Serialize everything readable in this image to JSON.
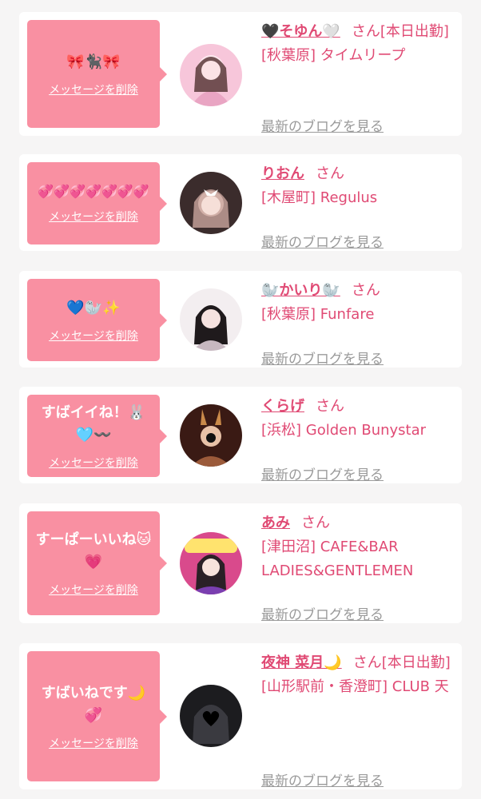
{
  "delete_label": "メッセージを削除",
  "blog_label": "最新のブログを見る",
  "honorific": "さん",
  "cards": [
    {
      "message": "🎀🐈‍⬛🎀",
      "name": "🖤そゆん🤍",
      "status": "[本日出勤]",
      "shop": "[秋葉原] タイムリープ",
      "avatar_colors": [
        "#f7c6da",
        "#e9a5c3"
      ]
    },
    {
      "message": "💞💞💞💞💞💞💞",
      "name": "りおん",
      "status": "",
      "shop": "[木屋町] Regulus",
      "avatar_colors": [
        "#3b2c2c",
        "#c9a59e"
      ]
    },
    {
      "message": "💙🦭✨",
      "name": "🦭かいり🦭",
      "status": "",
      "shop": "[秋葉原] Funfare",
      "avatar_colors": [
        "#f3eef0",
        "#c7b8c0"
      ]
    },
    {
      "message": "すばイイね！🐰🩵〰️",
      "name": "くらげ",
      "status": "",
      "shop": "[浜松] Golden Bunystar",
      "avatar_colors": [
        "#3a1a14",
        "#9b5a3a"
      ]
    },
    {
      "message": "すーぱーいいね🐱💗",
      "name": "あみ",
      "status": "",
      "shop": "[津田沼] CAFE&BAR LADIES&GENTLEMEN",
      "avatar_colors": [
        "#d94a8c",
        "#ffe36e"
      ]
    },
    {
      "message": "すばいねです🌙💞",
      "name": "夜神 菜月🌙",
      "status": "[本日出勤]",
      "shop": "[山形駅前・香澄町] CLUB 天",
      "avatar_colors": [
        "#1c1c1f",
        "#3a3a40"
      ]
    }
  ]
}
